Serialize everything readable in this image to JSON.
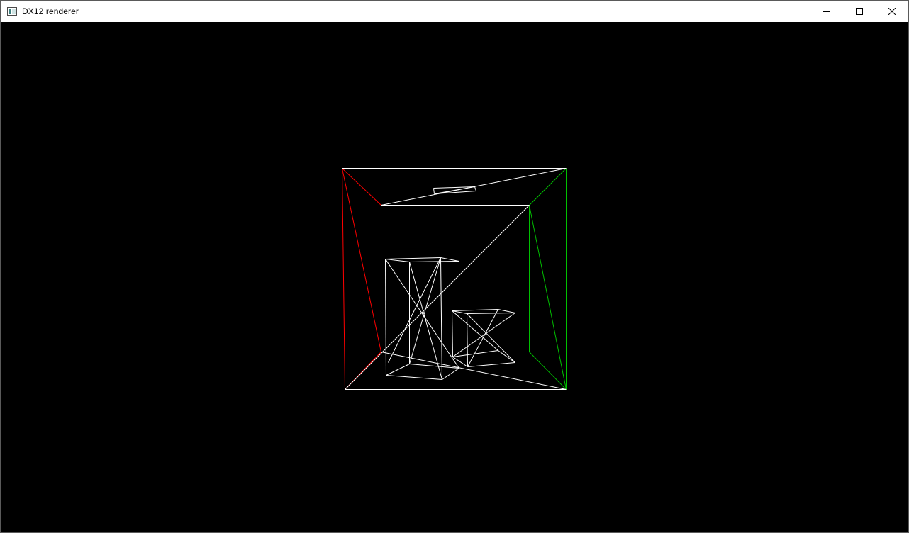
{
  "window": {
    "title": "DX12 renderer",
    "icon": "app-window-icon",
    "controls": {
      "minimize_icon": "minimize-icon",
      "maximize_icon": "maximize-icon",
      "close_icon": "close-icon"
    }
  },
  "viewport": {
    "background": "#000000",
    "render_mode": "wireframe",
    "scene": "cornell-box",
    "colors": {
      "left_wall": "#ff0000",
      "right_wall": "#00c000",
      "neutral": "#ffffff"
    }
  }
}
